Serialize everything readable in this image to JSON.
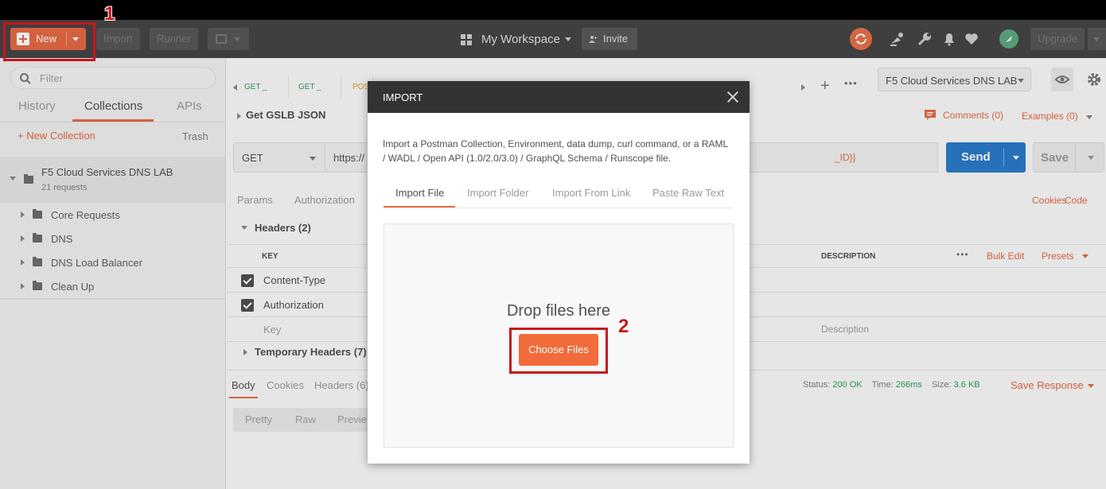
{
  "header": {
    "new_label": "New",
    "import_label": "Import",
    "runner_label": "Runner",
    "workspace_label": "My Workspace",
    "invite_label": "Invite",
    "upgrade_label": "Upgrade"
  },
  "sidebar": {
    "filter_placeholder": "Filter",
    "tabs": [
      "History",
      "Collections",
      "APIs"
    ],
    "new_collection_label": "+ New Collection",
    "trash_label": "Trash",
    "collection": {
      "name": "F5 Cloud Services DNS LAB",
      "count": "21 requests",
      "folders": [
        "Core Requests",
        "DNS",
        "DNS Load Balancer",
        "Clean Up"
      ]
    }
  },
  "request_tabs": [
    {
      "method": "GET",
      "suffix": "_"
    },
    {
      "method": "GET",
      "suffix": "_"
    },
    {
      "method": "POS",
      "suffix": ""
    }
  ],
  "main": {
    "environment": "F5 Cloud Services DNS LAB",
    "request_name": "Get GSLB JSON",
    "comments_label": "Comments (0)",
    "examples_label": "Examples (0)",
    "method": "GET",
    "url_prefix": "https://",
    "url_suffix": "_ID}}",
    "send_label": "Send",
    "save_label": "Save",
    "subtabs": [
      "Params",
      "Authorization"
    ],
    "cookies_label": "Cookies",
    "code_label": "Code",
    "headers_title": "Headers (2)",
    "table_headers": {
      "key": "KEY",
      "description": "DESCRIPTION"
    },
    "bulk_edit_label": "Bulk Edit",
    "presets_label": "Presets",
    "header_rows": [
      {
        "key": "Content-Type",
        "checked": true
      },
      {
        "key": "Authorization",
        "checked": true
      }
    ],
    "key_placeholder": "Key",
    "description_placeholder": "Description",
    "temp_headers_label": "Temporary Headers (7)",
    "response_tabs": [
      "Body",
      "Cookies",
      "Headers (6)"
    ],
    "status_label": "Status:",
    "status_value": "200 OK",
    "time_label": "Time:",
    "time_value": "266ms",
    "size_label": "Size:",
    "size_value": "3.6 KB",
    "save_response_label": "Save Response",
    "body_view_buttons": [
      "Pretty",
      "Raw",
      "Previe"
    ]
  },
  "modal": {
    "title": "IMPORT",
    "description": "Import a Postman Collection, Environment, data dump, curl command, or a RAML / WADL / Open API (1.0/2.0/3.0) / GraphQL Schema / Runscope file.",
    "tabs": [
      "Import File",
      "Import Folder",
      "Import From Link",
      "Paste Raw Text"
    ],
    "drop_text": "Drop files here",
    "choose_files_label": "Choose Files"
  },
  "annotations": [
    "1",
    "2"
  ],
  "colors": {
    "accent": "#e56a45",
    "header_bg": "#454545",
    "send_blue": "#2a7bc9",
    "annotation_red": "#c8161d",
    "status_green": "#2e9e5a"
  }
}
